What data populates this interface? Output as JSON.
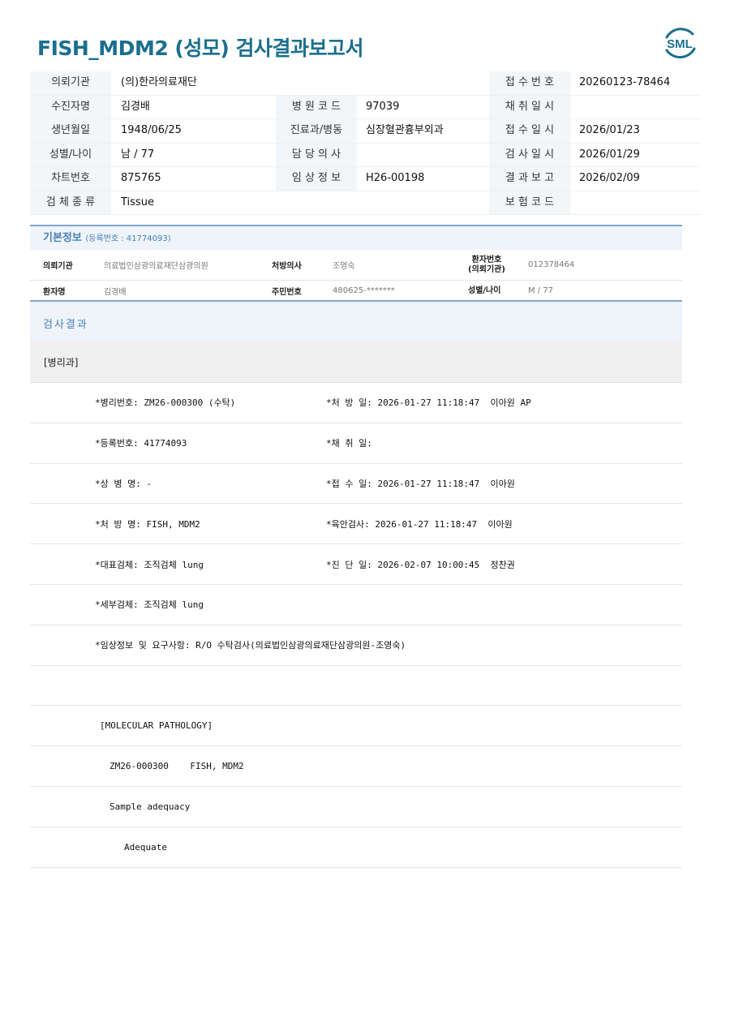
{
  "header": {
    "title": "FISH_MDM2 (성모) 검사결과보고서",
    "logo_text": "SML"
  },
  "info_table": [
    {
      "l1": "의뢰기관",
      "v1": "(의)한라의료재단",
      "l2": "",
      "v2": "",
      "l3": "접 수 번 호",
      "v3": "20260123-78464"
    },
    {
      "l1": "수진자명",
      "v1": "김경배",
      "l2": "병 원 코 드",
      "v2": "97039",
      "l3": "채 취 일 시",
      "v3": ""
    },
    {
      "l1": "생년월일",
      "v1": "1948/06/25",
      "l2": "진료과/병동",
      "v2": "심장혈관흉부외과",
      "l3": "접 수 일 시",
      "v3": "2026/01/23"
    },
    {
      "l1": "성별/나이",
      "v1": "남 / 77",
      "l2": "담 당 의 사",
      "v2": "",
      "l3": "검 사 일 시",
      "v3": "2026/01/29"
    },
    {
      "l1": "차트번호",
      "v1": "875765",
      "l2": "임 상 정 보",
      "v2": "H26-00198",
      "l3": "결 과 보 고",
      "v3": "2026/02/09"
    },
    {
      "l1": "검 체 종 류",
      "v1": "Tissue",
      "l2": "",
      "v2": "",
      "l3": "보 험 코 드",
      "v3": ""
    }
  ],
  "basic_info": {
    "heading": "기본정보",
    "reg_no": "(등록번호 : 41774093)",
    "row1": {
      "l1": "의뢰기관",
      "v1": "의료법인삼광의료재단삼광의원",
      "l2": "처방의사",
      "v2": "조영숙",
      "l3a": "환자번호",
      "l3b": "(의뢰기관)",
      "v3": "012378464"
    },
    "row2": {
      "l1": "환자명",
      "v1": "김경배",
      "l2": "주민번호",
      "v2": "480625-*******",
      "l3": "성별/나이",
      "v3": "M / 77"
    }
  },
  "result": {
    "heading": "검사결과",
    "section": "[병리과]",
    "pairs": [
      {
        "left": "*병리번호: ZM26-000300 (수탁)",
        "right": "*처 방 일: 2026-01-27 11:18:47  이아원 AP"
      },
      {
        "left": "*등록번호: 41774093",
        "right": "*채 취 일:"
      },
      {
        "left": "*상 병 명: -",
        "right": "*접 수 일: 2026-01-27 11:18:47  이아원"
      },
      {
        "left": "*처 방 명: FISH, MDM2",
        "right": "*육안검사: 2026-01-27 11:18:47  이아원"
      },
      {
        "left": "*대표검체: 조직검체 lung",
        "right": "*진 단 일: 2026-02-07 10:00:45  정찬권"
      },
      {
        "left": "*세부검체: 조직검체 lung",
        "right": ""
      },
      {
        "left": "*임상정보 및 요구사항: R/O 수탁검사(의료법인삼광의료재단삼광의원-조영숙)",
        "right": ""
      }
    ],
    "mol_title": "[MOLECULAR PATHOLOGY]",
    "mol_case": "ZM26-000300    FISH, MDM2",
    "adequacy_label": "Sample adequacy",
    "adequacy_value": "Adequate"
  }
}
